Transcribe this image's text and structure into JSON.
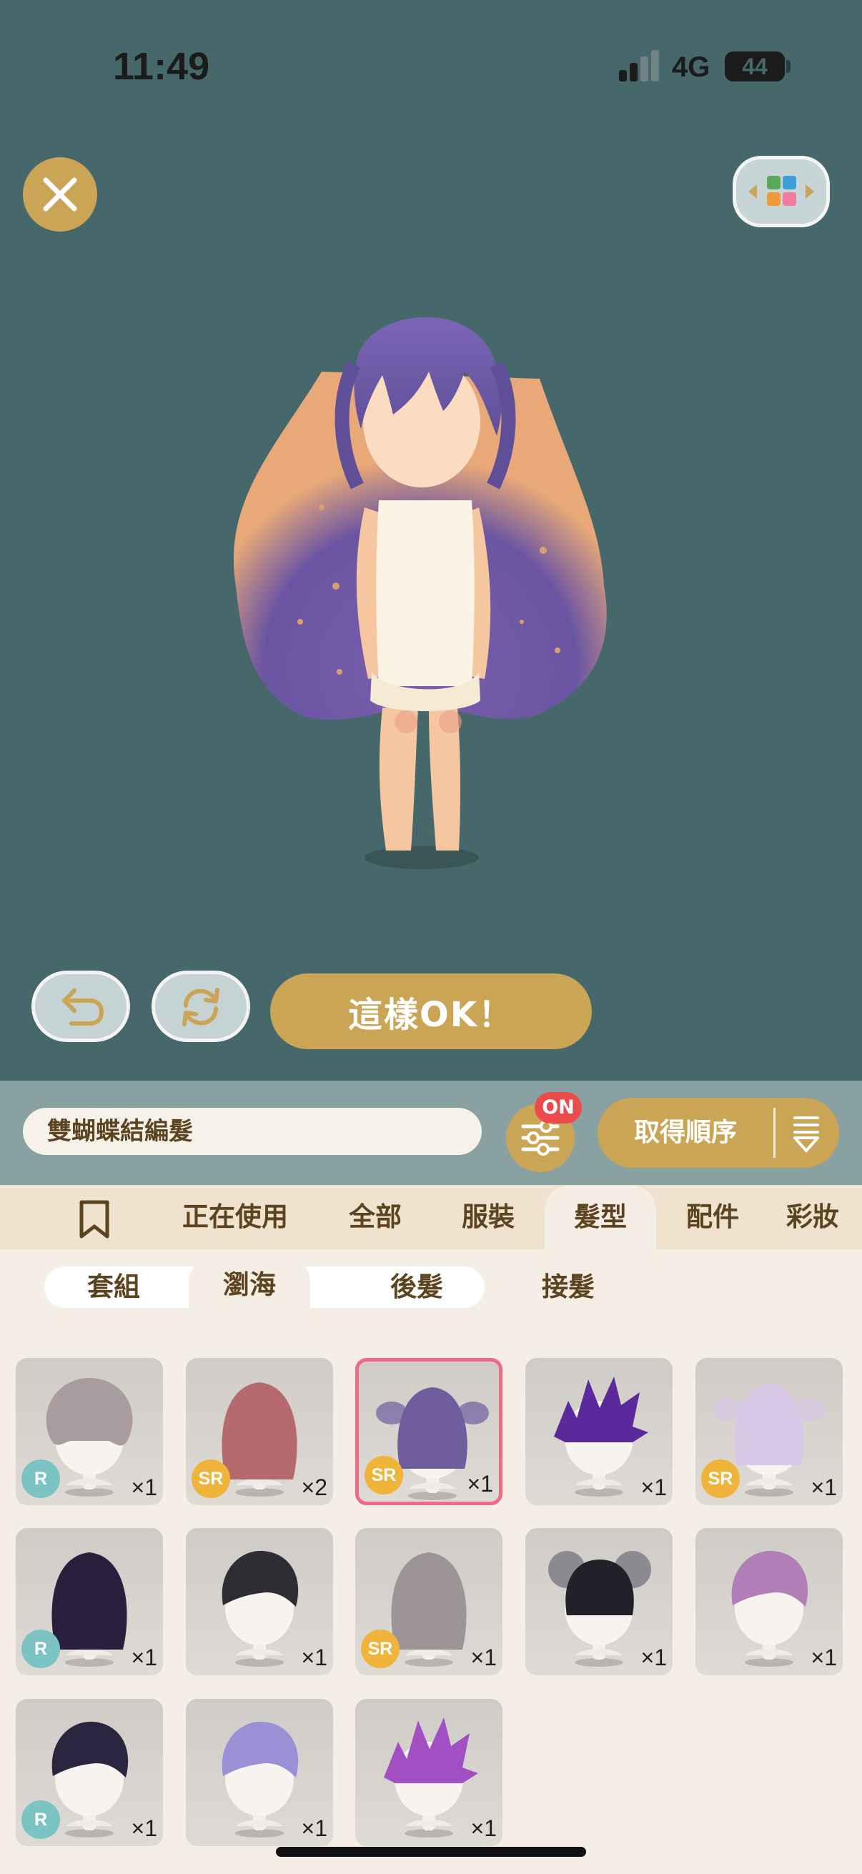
{
  "status_bar": {
    "time": "11:49",
    "network": "4G",
    "battery_level": "44",
    "battery_fraction": 0.44
  },
  "buttons": {
    "confirm_label": "這樣OK！"
  },
  "toolbar": {
    "search_value": "雙蝴蝶結編髮",
    "filter_badge": "ON",
    "order_label": "取得順序"
  },
  "tabs": [
    {
      "label": "正在使用"
    },
    {
      "label": "全部"
    },
    {
      "label": "服裝"
    },
    {
      "label": "髮型",
      "active": true
    },
    {
      "label": "配件"
    },
    {
      "label": "彩妝"
    }
  ],
  "subtabs": [
    {
      "label": "套組"
    },
    {
      "label": "瀏海",
      "active": true
    },
    {
      "label": "後髮"
    },
    {
      "label": "接髮"
    }
  ],
  "items": [
    {
      "rarity": "R",
      "qty": "×1",
      "hair": "wavy",
      "color": "#a99ca1"
    },
    {
      "rarity": "SR",
      "qty": "×2",
      "hair": "long",
      "color": "#b56a6e"
    },
    {
      "rarity": "SR",
      "qty": "×1",
      "hair": "bows",
      "color": "#6f5d9e",
      "selected": true
    },
    {
      "rarity": "",
      "qty": "×1",
      "hair": "spiky",
      "color": "#5a2a9c"
    },
    {
      "rarity": "SR",
      "qty": "×1",
      "hair": "bows",
      "color": "#d9c7e6"
    },
    {
      "rarity": "R",
      "qty": "×1",
      "hair": "long",
      "color": "#2a1f3d"
    },
    {
      "rarity": "",
      "qty": "×1",
      "hair": "short",
      "color": "#2d2d33"
    },
    {
      "rarity": "SR",
      "qty": "×1",
      "hair": "long",
      "color": "#9d9498"
    },
    {
      "rarity": "",
      "qty": "×1",
      "hair": "buns",
      "color": "#222028"
    },
    {
      "rarity": "",
      "qty": "×1",
      "hair": "short",
      "color": "#b07fb7"
    },
    {
      "rarity": "R",
      "qty": "×1",
      "hair": "short",
      "color": "#2b2540"
    },
    {
      "rarity": "",
      "qty": "×1",
      "hair": "short",
      "color": "#9b8fd6"
    },
    {
      "rarity": "",
      "qty": "×1",
      "hair": "spiky",
      "color": "#a34fc4"
    }
  ],
  "colors": {
    "gold": "#c9a555",
    "stage": "#46686a",
    "accent_pink": "#f06a88",
    "rarity_r": "#7cc4c4",
    "rarity_sr": "#f0b43a"
  }
}
